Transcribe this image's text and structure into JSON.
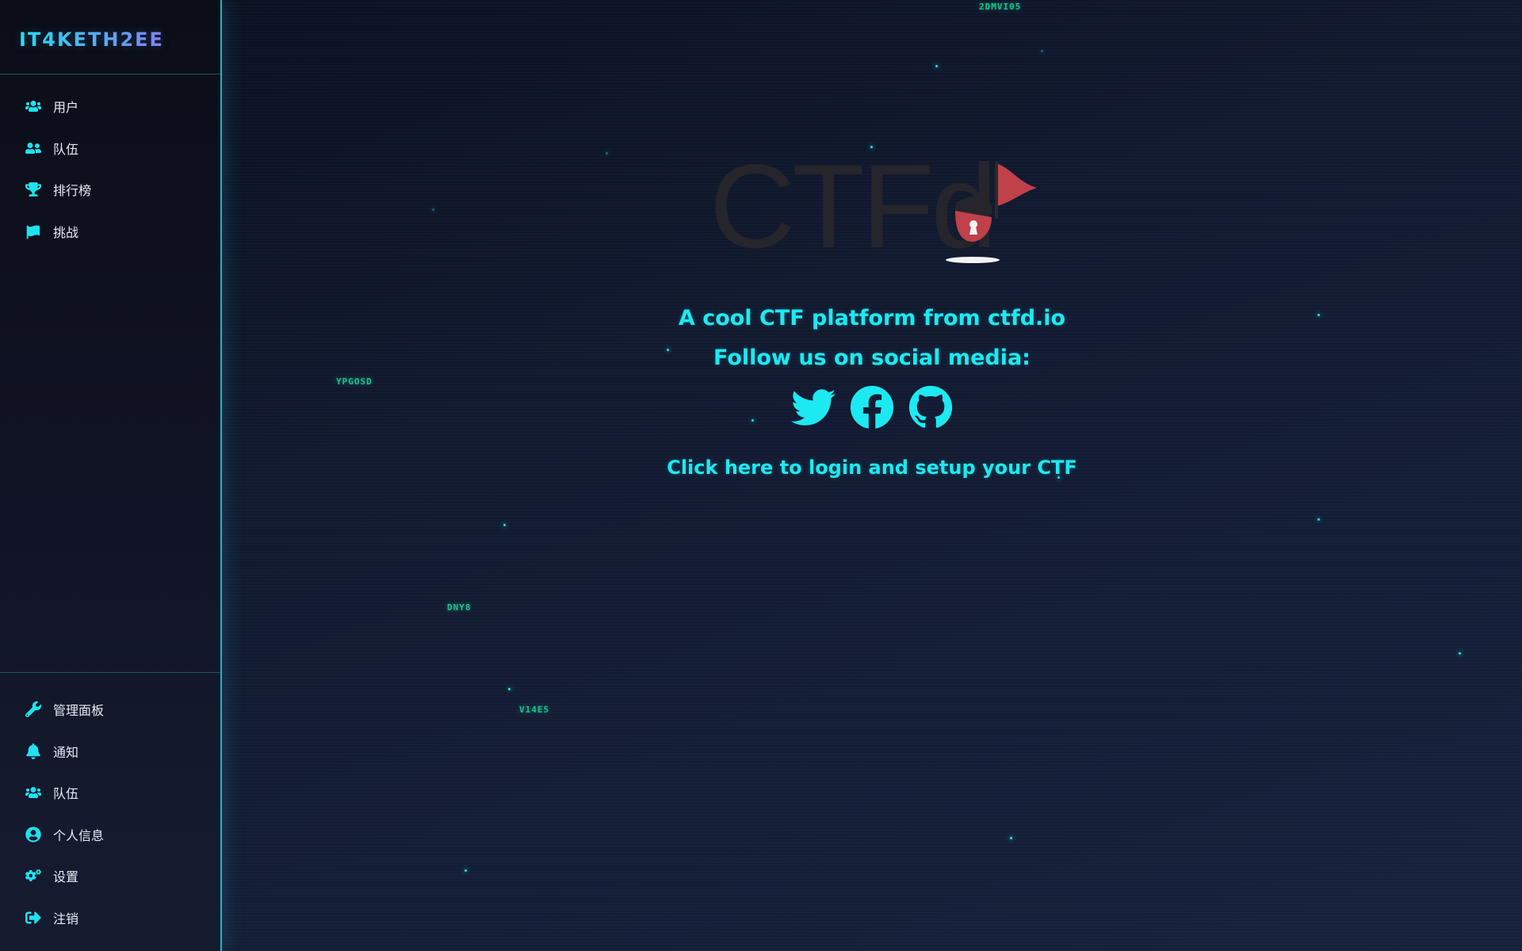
{
  "brand": {
    "title": "IT4KETH2EE"
  },
  "sidebar": {
    "top_items": [
      {
        "label": "用户",
        "icon": "users-icon"
      },
      {
        "label": "队伍",
        "icon": "team-icon"
      },
      {
        "label": "排行榜",
        "icon": "trophy-icon"
      },
      {
        "label": "挑战",
        "icon": "flag-icon"
      }
    ],
    "bottom_items": [
      {
        "label": "管理面板",
        "icon": "wrench-icon"
      },
      {
        "label": "通知",
        "icon": "bell-icon"
      },
      {
        "label": "队伍",
        "icon": "users-icon"
      },
      {
        "label": "个人信息",
        "icon": "user-circle-icon"
      },
      {
        "label": "设置",
        "icon": "gears-icon"
      },
      {
        "label": "注销",
        "icon": "sign-out-icon"
      }
    ]
  },
  "main": {
    "logo_text": "CTFd",
    "tagline": "A cool CTF platform from ctfd.io",
    "follow": "Follow us on social media:",
    "social": [
      "twitter-icon",
      "facebook-icon",
      "github-icon"
    ],
    "login_link": "Click here to login and setup your CTF"
  },
  "background_codes": [
    "2DMVI05",
    "YPGOSD",
    "DNY8",
    "V14E5"
  ],
  "colors": {
    "accent": "#1de9f2",
    "brand_gradient_start": "#1ee4f0",
    "brand_gradient_end": "#8e7cf2",
    "code": "#1fe0a0",
    "logo_red": "#c0414a"
  }
}
